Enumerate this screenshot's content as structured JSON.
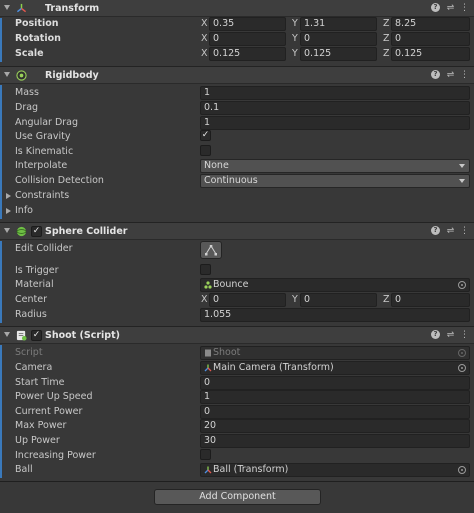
{
  "transform": {
    "title": "Transform",
    "rows": [
      {
        "label": "Position",
        "x": "0.35",
        "y": "1.31",
        "z": "8.25"
      },
      {
        "label": "Rotation",
        "x": "0",
        "y": "0",
        "z": "0"
      },
      {
        "label": "Scale",
        "x": "0.125",
        "y": "0.125",
        "z": "0.125"
      }
    ]
  },
  "axes": {
    "x": "X",
    "y": "Y",
    "z": "Z"
  },
  "rigidbody": {
    "title": "Rigidbody",
    "mass_label": "Mass",
    "mass": "1",
    "drag_label": "Drag",
    "drag": "0.1",
    "angular_drag_label": "Angular Drag",
    "angular_drag": "1",
    "use_gravity_label": "Use Gravity",
    "use_gravity": true,
    "is_kinematic_label": "Is Kinematic",
    "is_kinematic": false,
    "interpolate_label": "Interpolate",
    "interpolate": "None",
    "collision_label": "Collision Detection",
    "collision": "Continuous",
    "constraints_label": "Constraints",
    "info_label": "Info"
  },
  "sphere_collider": {
    "title": "Sphere Collider",
    "enabled": true,
    "edit_collider_label": "Edit Collider",
    "is_trigger_label": "Is Trigger",
    "is_trigger": false,
    "material_label": "Material",
    "material": "Bounce",
    "center_label": "Center",
    "center_x": "0",
    "center_y": "0",
    "center_z": "0",
    "radius_label": "Radius",
    "radius": "1.055"
  },
  "shoot_script": {
    "title": "Shoot (Script)",
    "enabled": true,
    "script_label": "Script",
    "script": "Shoot",
    "camera_label": "Camera",
    "camera": "Main Camera (Transform)",
    "start_time_label": "Start Time",
    "start_time": "0",
    "power_up_speed_label": "Power Up Speed",
    "power_up_speed": "1",
    "current_power_label": "Current Power",
    "current_power": "0",
    "max_power_label": "Max Power",
    "max_power": "20",
    "up_power_label": "Up Power",
    "up_power": "30",
    "increasing_power_label": "Increasing Power",
    "increasing_power": false,
    "ball_label": "Ball",
    "ball": "Ball (Transform)"
  },
  "add_component_label": "Add Component",
  "icons": {
    "help": "?",
    "settings": "⇌",
    "more": "⋮",
    "check": "✓"
  },
  "colors": {
    "accent_bar": "#3a79bb",
    "background": "#383838",
    "field": "#2a2a2a"
  }
}
